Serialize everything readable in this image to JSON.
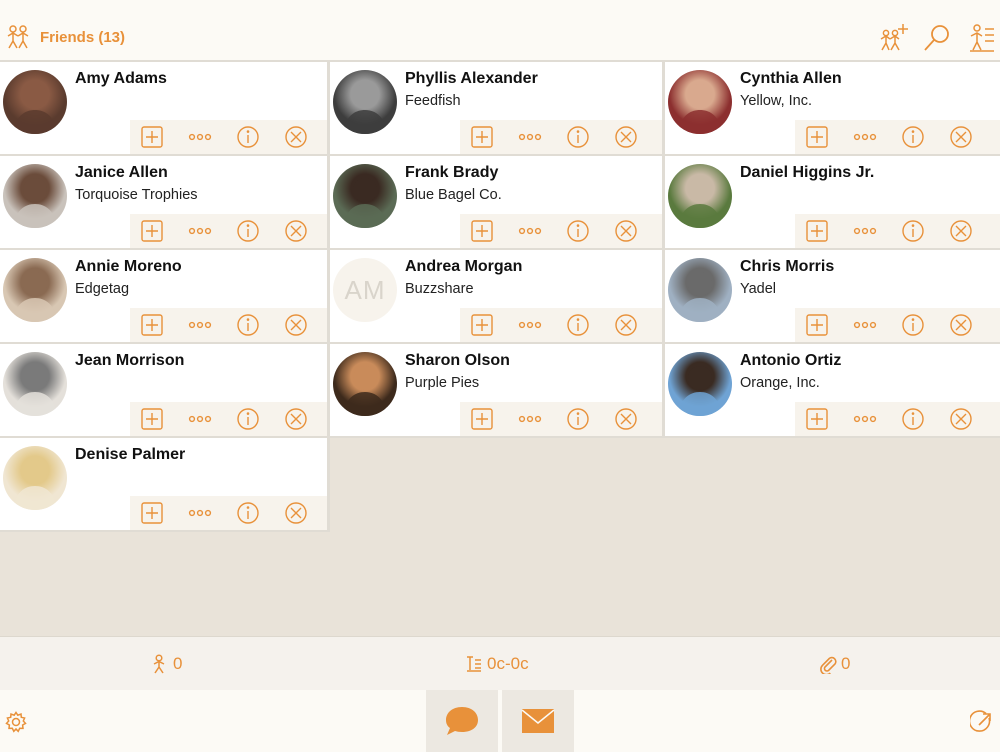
{
  "header": {
    "title": "Friends (13)",
    "friends_icon": "friends-icon",
    "add_friend_icon": "add-friends-icon",
    "search_icon": "search-icon",
    "list_icon": "list-settings-icon"
  },
  "colors": {
    "accent": "#e8913a",
    "card": "#ffffff",
    "background": "#e9e3d9",
    "action_strip": "#f7f3ec"
  },
  "contacts": [
    {
      "name": "Amy Adams",
      "company": "",
      "avatar": "photo"
    },
    {
      "name": "Phyllis Alexander",
      "company": "Feedfish",
      "avatar": "photo"
    },
    {
      "name": "Cynthia Allen",
      "company": "Yellow, Inc.",
      "avatar": "photo"
    },
    {
      "name": "Janice Allen",
      "company": "Torquoise Trophies",
      "avatar": "photo"
    },
    {
      "name": "Frank Brady",
      "company": "Blue Bagel Co.",
      "avatar": "photo"
    },
    {
      "name": "Daniel Higgins Jr.",
      "company": "",
      "avatar": "photo"
    },
    {
      "name": "Annie Moreno",
      "company": "Edgetag",
      "avatar": "photo"
    },
    {
      "name": "Andrea Morgan",
      "company": "Buzzshare",
      "avatar": "initials",
      "initials": "AM"
    },
    {
      "name": "Chris Morris",
      "company": "Yadel",
      "avatar": "photo"
    },
    {
      "name": "Jean Morrison",
      "company": "",
      "avatar": "photo"
    },
    {
      "name": "Sharon Olson",
      "company": "Purple Pies",
      "avatar": "photo"
    },
    {
      "name": "Antonio Ortiz",
      "company": "Orange, Inc.",
      "avatar": "photo"
    },
    {
      "name": "Denise Palmer",
      "company": "",
      "avatar": "photo"
    }
  ],
  "card_actions": [
    "add-icon",
    "more-icon",
    "info-icon",
    "remove-icon"
  ],
  "status": {
    "people_count": "0",
    "notes_range": "0c-0c",
    "attachments_count": "0"
  },
  "bottom": {
    "settings_icon": "gear-icon",
    "chat_icon": "chat-bubble-icon",
    "mail_icon": "mail-icon",
    "share_icon": "share-icon"
  }
}
